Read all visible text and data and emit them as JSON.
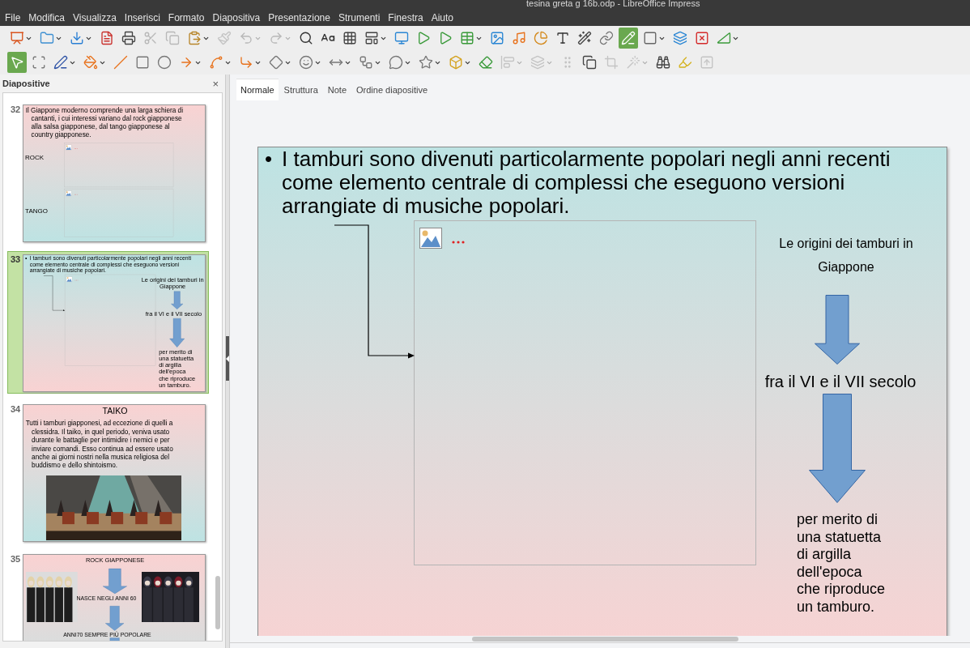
{
  "window": {
    "title": "tesina greta g 16b.odp - LibreOffice Impress"
  },
  "menu": [
    "File",
    "Modifica",
    "Visualizza",
    "Inserisci",
    "Formato",
    "Diapositiva",
    "Presentazione",
    "Strumenti",
    "Finestra",
    "Aiuto"
  ],
  "toolbars": [
    [
      {
        "disabled": false,
        "dropdown": true,
        "selected": false
      },
      {
        "disabled": false,
        "dropdown": true,
        "selected": false
      },
      {
        "disabled": false,
        "dropdown": true,
        "selected": false
      },
      {
        "disabled": false,
        "dropdown": false,
        "selected": false
      },
      {
        "disabled": false,
        "dropdown": false,
        "selected": false
      },
      {
        "disabled": true,
        "dropdown": false,
        "selected": false
      },
      {
        "disabled": true,
        "dropdown": false,
        "selected": false
      },
      {
        "disabled": false,
        "dropdown": true,
        "selected": false
      },
      {
        "disabled": true,
        "dropdown": false,
        "selected": false
      },
      {
        "disabled": true,
        "dropdown": true,
        "selected": false
      },
      {
        "disabled": true,
        "dropdown": true,
        "selected": false
      },
      {
        "disabled": false,
        "dropdown": false,
        "selected": false
      },
      {
        "disabled": false,
        "dropdown": false,
        "selected": false
      },
      {
        "disabled": false,
        "dropdown": false,
        "selected": false
      },
      {
        "disabled": false,
        "dropdown": true,
        "selected": false
      },
      {
        "disabled": false,
        "dropdown": false,
        "selected": false
      },
      {
        "disabled": false,
        "dropdown": false,
        "selected": false
      },
      {
        "disabled": false,
        "dropdown": false,
        "selected": false
      },
      {
        "disabled": false,
        "dropdown": true,
        "selected": false
      },
      {
        "disabled": false,
        "dropdown": false,
        "selected": false
      },
      {
        "disabled": false,
        "dropdown": false,
        "selected": false
      },
      {
        "disabled": false,
        "dropdown": false,
        "selected": false
      },
      {
        "disabled": false,
        "dropdown": false,
        "selected": false
      },
      {
        "disabled": false,
        "dropdown": false,
        "selected": false
      },
      {
        "disabled": false,
        "dropdown": false,
        "selected": false
      },
      {
        "disabled": false,
        "dropdown": false,
        "selected": true
      },
      {
        "disabled": false,
        "dropdown": true,
        "selected": false
      },
      {
        "disabled": false,
        "dropdown": false,
        "selected": false
      },
      {
        "disabled": false,
        "dropdown": false,
        "selected": false
      },
      {
        "disabled": false,
        "dropdown": true,
        "selected": false
      }
    ],
    [
      {
        "disabled": false,
        "dropdown": false,
        "selected": true
      },
      {
        "disabled": false,
        "dropdown": false,
        "selected": false
      },
      {
        "disabled": false,
        "dropdown": true,
        "selected": false
      },
      {
        "disabled": false,
        "dropdown": true,
        "selected": false
      },
      {
        "disabled": false,
        "dropdown": false,
        "selected": false
      },
      {
        "disabled": false,
        "dropdown": false,
        "selected": false
      },
      {
        "disabled": false,
        "dropdown": false,
        "selected": false
      },
      {
        "disabled": false,
        "dropdown": true,
        "selected": false
      },
      {
        "disabled": false,
        "dropdown": true,
        "selected": false
      },
      {
        "disabled": false,
        "dropdown": true,
        "selected": false
      },
      {
        "disabled": false,
        "dropdown": true,
        "selected": false
      },
      {
        "disabled": false,
        "dropdown": true,
        "selected": false
      },
      {
        "disabled": false,
        "dropdown": true,
        "selected": false
      },
      {
        "disabled": false,
        "dropdown": true,
        "selected": false
      },
      {
        "disabled": false,
        "dropdown": true,
        "selected": false
      },
      {
        "disabled": false,
        "dropdown": true,
        "selected": false
      },
      {
        "disabled": false,
        "dropdown": true,
        "selected": false
      },
      {
        "disabled": false,
        "dropdown": false,
        "selected": false
      },
      {
        "disabled": true,
        "dropdown": true,
        "selected": false
      },
      {
        "disabled": true,
        "dropdown": true,
        "selected": false
      },
      {
        "disabled": true,
        "dropdown": false,
        "selected": false
      },
      {
        "disabled": false,
        "dropdown": false,
        "selected": false
      },
      {
        "disabled": true,
        "dropdown": false,
        "selected": false
      },
      {
        "disabled": true,
        "dropdown": true,
        "selected": false
      },
      {
        "disabled": false,
        "dropdown": false,
        "selected": false
      },
      {
        "disabled": false,
        "dropdown": false,
        "selected": false
      },
      {
        "disabled": true,
        "dropdown": false,
        "selected": false
      }
    ]
  ],
  "slides_panel": {
    "title": "Diapositive",
    "close": "×",
    "slides": [
      {
        "number": "32",
        "selected": false,
        "kind": "text_images",
        "text": "Il Giappone moderno comprende una larga schiera di\ncantanti, i cui interessi variano dal rock giapponese\nalla salsa giapponese, dal tango giapponese al\ncountry giapponese.",
        "labels": [
          "ROCK",
          "TANGO"
        ]
      },
      {
        "number": "33",
        "selected": true,
        "kind": "bullet_diagram",
        "bullet": "•",
        "text": "I tamburi sono divenuti particolarmente popolari negli anni recenti come elemento centrale di complessi che eseguono versioni arrangiate di musiche popolari.",
        "captions": [
          "Le origini dei tamburi in\nGiappone",
          "fra il VI e il VII secolo",
          "per merito di\nuna statuetta\ndi argilla\ndell'epoca\nche riproduce\nun tamburo."
        ]
      },
      {
        "number": "34",
        "selected": false,
        "kind": "title_photo",
        "title": "TAIKO",
        "text": "Tutti i tamburi giapponesi, ad eccezione di quelli a\nclessidra. Il taiko, in quel periodo, veniva usato\ndurante le battaglie per intimidire i nemici e per\ninviare comandi. Esso continua ad essere usato\nanche ai giorni nostri nella musica religiosa del\nbuddismo e dello shintoismo."
      },
      {
        "number": "35",
        "selected": false,
        "kind": "title_photos_arrows",
        "title": "ROCK GIAPPONESE",
        "captions": [
          "NASCE NEGLI ANNI 60",
          "ANNI70 SEMPRE PIÙ POPOLARE"
        ]
      }
    ]
  },
  "view_tabs": [
    {
      "label": "Normale",
      "selected": true
    },
    {
      "label": "Struttura",
      "selected": false
    },
    {
      "label": "Note",
      "selected": false
    },
    {
      "label": "Ordine diapositive",
      "selected": false
    }
  ],
  "editor_slide": {
    "kind": "bullet_diagram",
    "bullet": "•",
    "text": "I tamburi sono divenuti particolarmente popolari negli anni recenti come elemento centrale di complessi che eseguono versioni arrangiate di musiche popolari.",
    "captions": [
      "Le origini dei tamburi in\nGiappone",
      "fra il VI e il VII secolo",
      "per merito di\nuna statuetta\ndi argilla\ndell'epoca\nche riproduce\nun tamburo."
    ]
  }
}
